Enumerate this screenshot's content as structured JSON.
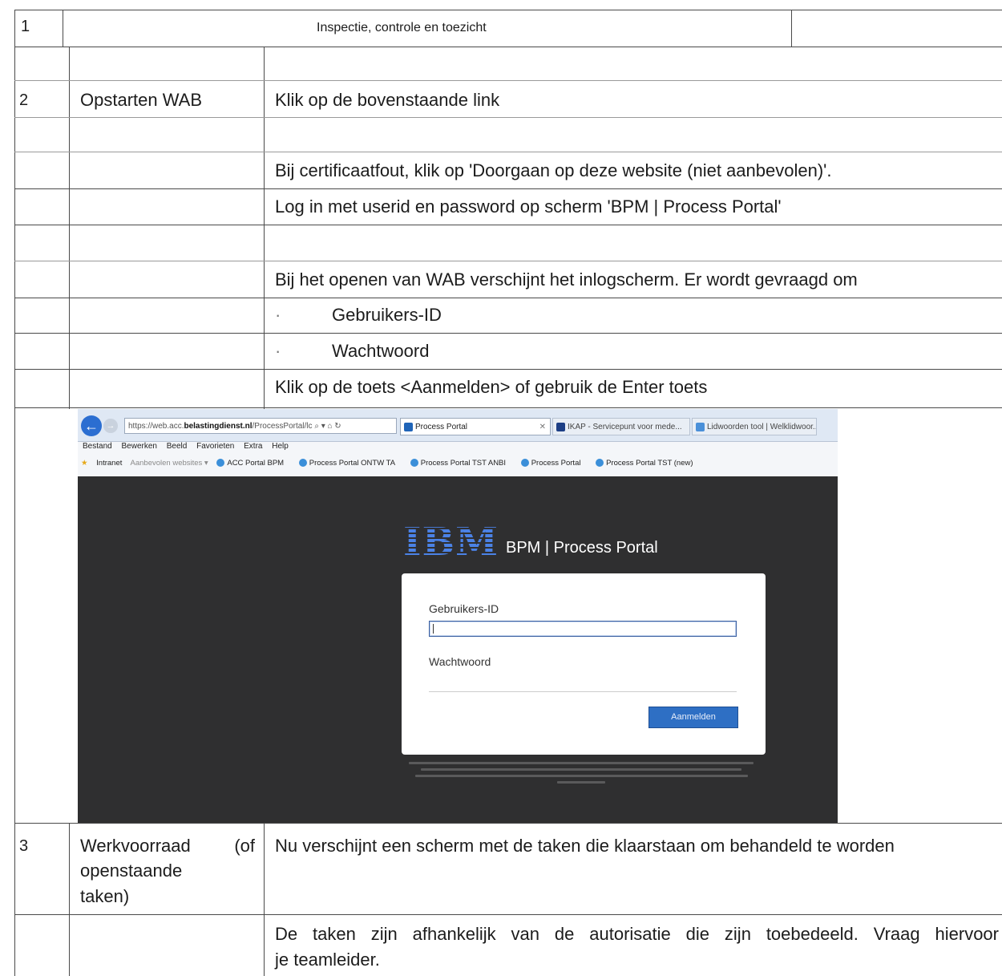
{
  "row1": {
    "number": "1",
    "title": "Inspectie, controle en toezicht"
  },
  "row2": {
    "number": "2",
    "label": "Opstarten WAB",
    "lines": [
      "Klik op de bovenstaande link",
      "Bij certificaatfout, klik op 'Doorgaan op deze website (niet aanbevolen)'.",
      "Log in met userid en password op scherm 'BPM | Process Portal'",
      "Bij het openen van WAB verschijnt het inlogscherm. Er wordt gevraagd om",
      "Klik op de toets <Aanmelden> of gebruik de Enter toets"
    ],
    "bullets": [
      "Gebruikers-ID",
      "Wachtwoord"
    ],
    "bullet_char": "·"
  },
  "screenshot": {
    "url_prefix": "https://web.acc.",
    "url_domain": "belastingdienst.nl",
    "url_path": "/ProcessPortal/lc",
    "url_controls": "⌕ ▾ ⌂ ↻",
    "tabs": [
      {
        "label": "Process Portal",
        "active": true,
        "color": "#1f64b8"
      },
      {
        "label": "IKAP - Servicepunt voor mede...",
        "active": false,
        "color": "#1d3f86"
      },
      {
        "label": "Lidwoorden tool | Welklidwoor...",
        "active": false,
        "color": "#4a90d9"
      }
    ],
    "menu": [
      "Bestand",
      "Bewerken",
      "Beeld",
      "Favorieten",
      "Extra",
      "Help"
    ],
    "favorites": [
      "Intranet",
      "Aanbevolen websites ▾",
      "ACC Portal BPM",
      "Process Portal ONTW TA",
      "Process Portal TST ANBI",
      "Process Portal",
      "Process Portal TST (new)"
    ],
    "logo": "IBM",
    "portal_title": "BPM | Process Portal",
    "user_label": "Gebruikers-ID",
    "password_label": "Wachtwoord",
    "login_button": "Aanmelden"
  },
  "row3": {
    "number": "3",
    "label_lines": [
      "Werkvoorraad (of",
      "openstaande",
      "taken)"
    ],
    "lines": [
      "Nu verschijnt een scherm met de taken die klaarstaan om behandeld te worden",
      "De taken zijn afhankelijk van de autorisatie die zijn toebedeeld. Vraag hiervoor",
      "je teamleider."
    ]
  },
  "colors": {
    "grid": "#4a4a4a",
    "ibm_blue": "#3a6fd4",
    "portal_bg": "#2f2f30",
    "button_blue": "#2e6fc4"
  }
}
